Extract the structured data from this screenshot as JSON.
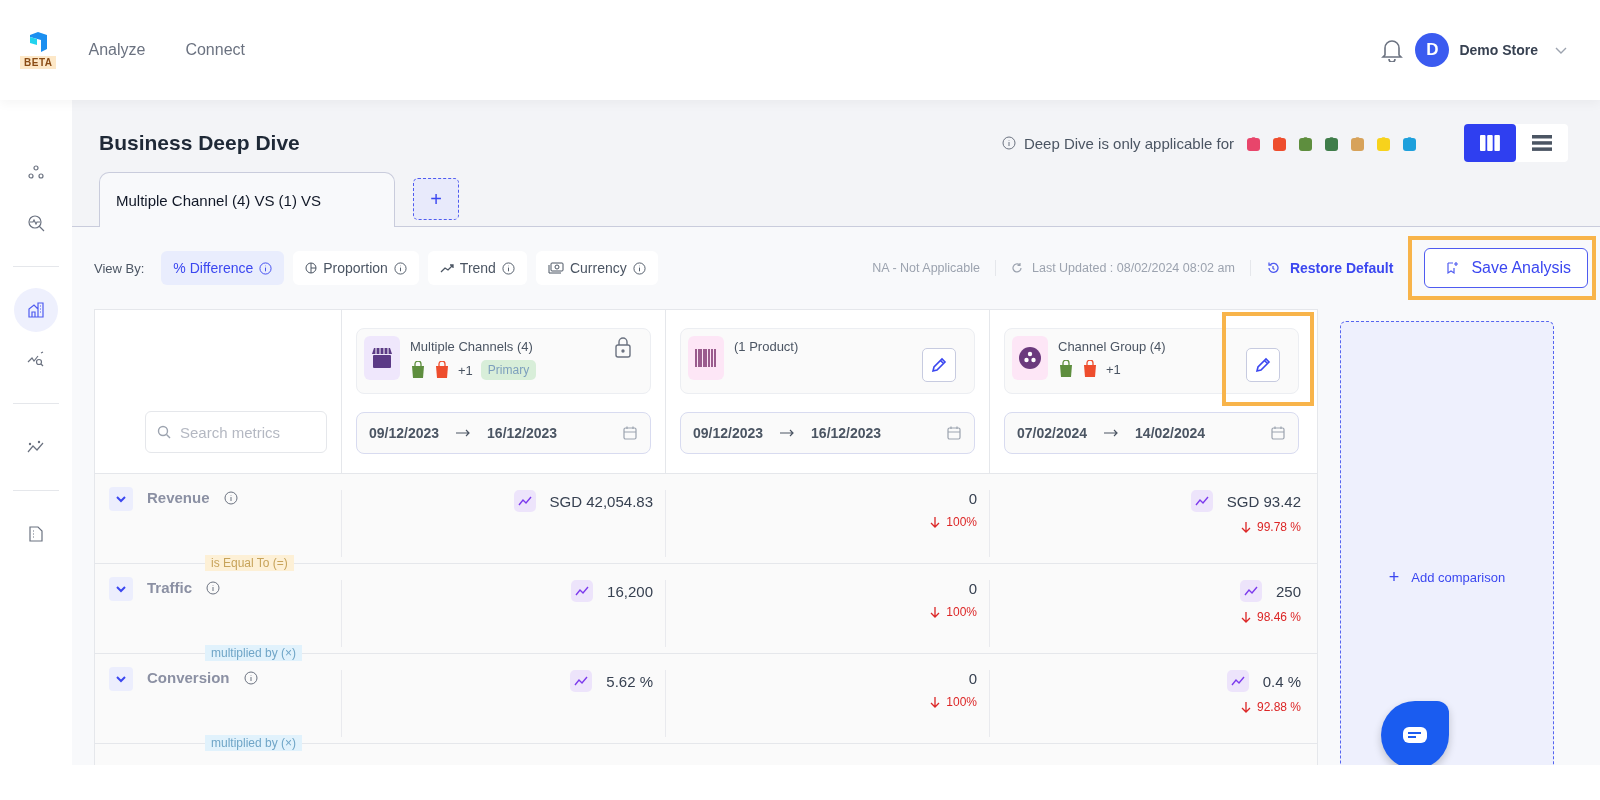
{
  "nav": {
    "badge": "BETA",
    "menu": [
      {
        "label": "Analyze",
        "selected": false
      },
      {
        "label": "Connect",
        "selected": false
      }
    ],
    "user": {
      "initial": "D",
      "name": "Demo Store"
    }
  },
  "sidebar": [
    {
      "kind": "nodes",
      "selected": false
    },
    {
      "kind": "inspect",
      "selected": false
    },
    {
      "kind": "building",
      "selected": true
    },
    {
      "kind": "trend-search",
      "selected": false
    },
    {
      "kind": "scatter",
      "selected": false
    },
    {
      "kind": "document",
      "selected": false
    }
  ],
  "page": {
    "title": "Business Deep Dive",
    "notice": "Deep Dive is only applicable for",
    "views": [
      {
        "kind": "columns",
        "selected": true
      },
      {
        "kind": "list",
        "selected": false
      }
    ]
  },
  "tabs": [
    {
      "label": "Multiple Channel (4) VS (1) VS",
      "selected": true
    }
  ],
  "add_tab": "+",
  "toolbar": {
    "label": "View By:",
    "options": [
      {
        "kind": "percent",
        "label": "% Difference",
        "selected": true
      },
      {
        "kind": "pie",
        "label": "Proportion",
        "selected": false
      },
      {
        "kind": "trend",
        "label": "Trend",
        "selected": false
      },
      {
        "kind": "currency",
        "label": "Currency",
        "selected": false
      }
    ],
    "na": "NA - Not Applicable",
    "updated": "Last Updated : 08/02/2024 08:02 am",
    "restore": "Restore Default",
    "save": {
      "label": "Save Analysis",
      "highlighted": true
    }
  },
  "search": {
    "placeholder": "Search metrics"
  },
  "columns": [
    {
      "kind": "channels",
      "title": "Multiple Channels (4)",
      "more": "+1",
      "badge": "Primary",
      "locked": true,
      "date_from": "09/12/2023",
      "date_to": "16/12/2023"
    },
    {
      "kind": "product",
      "title": "(1 Product)",
      "locked": false,
      "highlighted": false,
      "date_from": "09/12/2023",
      "date_to": "16/12/2023"
    },
    {
      "kind": "group",
      "title": "Channel Group (4)",
      "more": "+1",
      "locked": false,
      "highlighted": true,
      "date_from": "07/02/2024",
      "date_to": "14/02/2024"
    }
  ],
  "metrics": [
    {
      "name": "Revenue",
      "link": "is Equal To (=)",
      "kind": "equal",
      "cells": [
        {
          "value": "SGD 42,054.83",
          "trend": true
        },
        {
          "value": "0",
          "trend": false,
          "change": "100%"
        },
        {
          "value": "SGD 93.42",
          "trend": true,
          "change": "99.78 %"
        }
      ]
    },
    {
      "name": "Traffic",
      "link": "multiplied by (×)",
      "kind": "multiply",
      "cells": [
        {
          "value": "16,200",
          "trend": true
        },
        {
          "value": "0",
          "trend": false,
          "change": "100%"
        },
        {
          "value": "250",
          "trend": true,
          "change": "98.46 %"
        }
      ]
    },
    {
      "name": "Conversion",
      "link": "multiplied by (×)",
      "kind": "multiply",
      "cells": [
        {
          "value": "5.62 %",
          "trend": true
        },
        {
          "value": "0",
          "trend": false,
          "change": "100%"
        },
        {
          "value": "0.4 %",
          "trend": true,
          "change": "92.88 %"
        }
      ]
    }
  ],
  "add_comparison": {
    "icon": "+",
    "label": "Add comparison"
  }
}
